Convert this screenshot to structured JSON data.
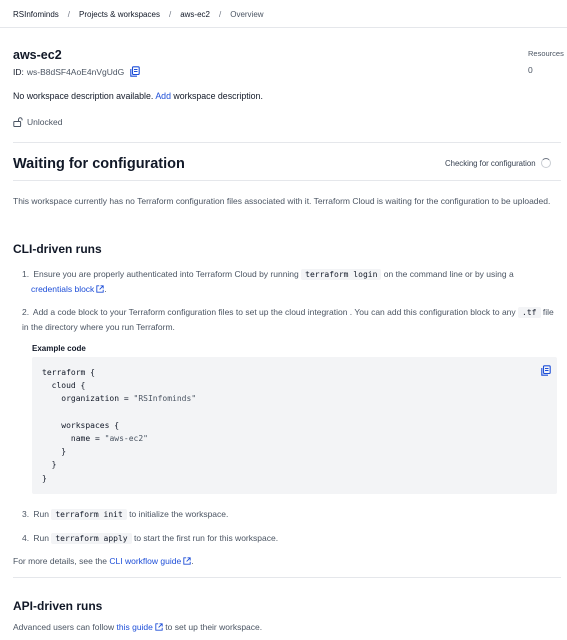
{
  "breadcrumb": {
    "items": [
      "RSInfominds",
      "Projects & workspaces",
      "aws-ec2",
      "Overview"
    ],
    "separator": "/"
  },
  "workspace": {
    "name": "aws-ec2",
    "id_label": "ID:",
    "id_value": "ws-B8dSF4AoE4nVgUdG",
    "desc_prefix": "No workspace description available.",
    "desc_link": "Add",
    "desc_suffix": "workspace description.",
    "lock_status": "Unlocked"
  },
  "resources": {
    "label": "Resources",
    "count": "0"
  },
  "config": {
    "title": "Waiting for configuration",
    "status": "Checking for configuration",
    "intro": "This workspace currently has no Terraform configuration files associated with it. Terraform Cloud is waiting for the configuration to be uploaded."
  },
  "cli": {
    "title": "CLI-driven runs",
    "step1_num": "1.",
    "step1_pre": "Ensure you are properly authenticated into Terraform Cloud by running",
    "step1_code": "terraform login",
    "step1_mid": "on the command line or by using a",
    "step1_link": "credentials block",
    "step1_end": ".",
    "step2_num": "2.",
    "step2_pre": "Add a code block to your Terraform configuration files to set up the cloud integration . You can add this configuration block to any",
    "step2_code": ".tf",
    "step2_end": "file in the directory where you run Terraform.",
    "example_label": "Example code",
    "code_lines": {
      "l1": "terraform {",
      "l2": "  cloud {",
      "l3_pre": "    organization = ",
      "l3_str": "\"RSInfominds\"",
      "l5": "    workspaces {",
      "l6_pre": "      name = ",
      "l6_str": "\"aws-ec2\"",
      "l7": "    }",
      "l8": "  }",
      "l9": "}"
    },
    "step3_num": "3.",
    "step3_pre": "Run",
    "step3_code": "terraform init",
    "step3_end": "to initialize the workspace.",
    "step4_num": "4.",
    "step4_pre": "Run",
    "step4_code": "terraform apply",
    "step4_end": "to start the first run for this workspace.",
    "more_pre": "For more details, see the",
    "more_link": "CLI workflow guide",
    "more_end": "."
  },
  "api": {
    "title": "API-driven runs",
    "desc_pre": "Advanced users can follow",
    "desc_link": "this guide",
    "desc_end": "to set up their workspace."
  },
  "colors": {
    "link": "#1d4ed8",
    "code_bg": "#f3f4f6",
    "divider": "#e5e7eb"
  },
  "icons": [
    "copy-icon",
    "unlock-icon",
    "spinner-icon",
    "external-link-icon"
  ]
}
